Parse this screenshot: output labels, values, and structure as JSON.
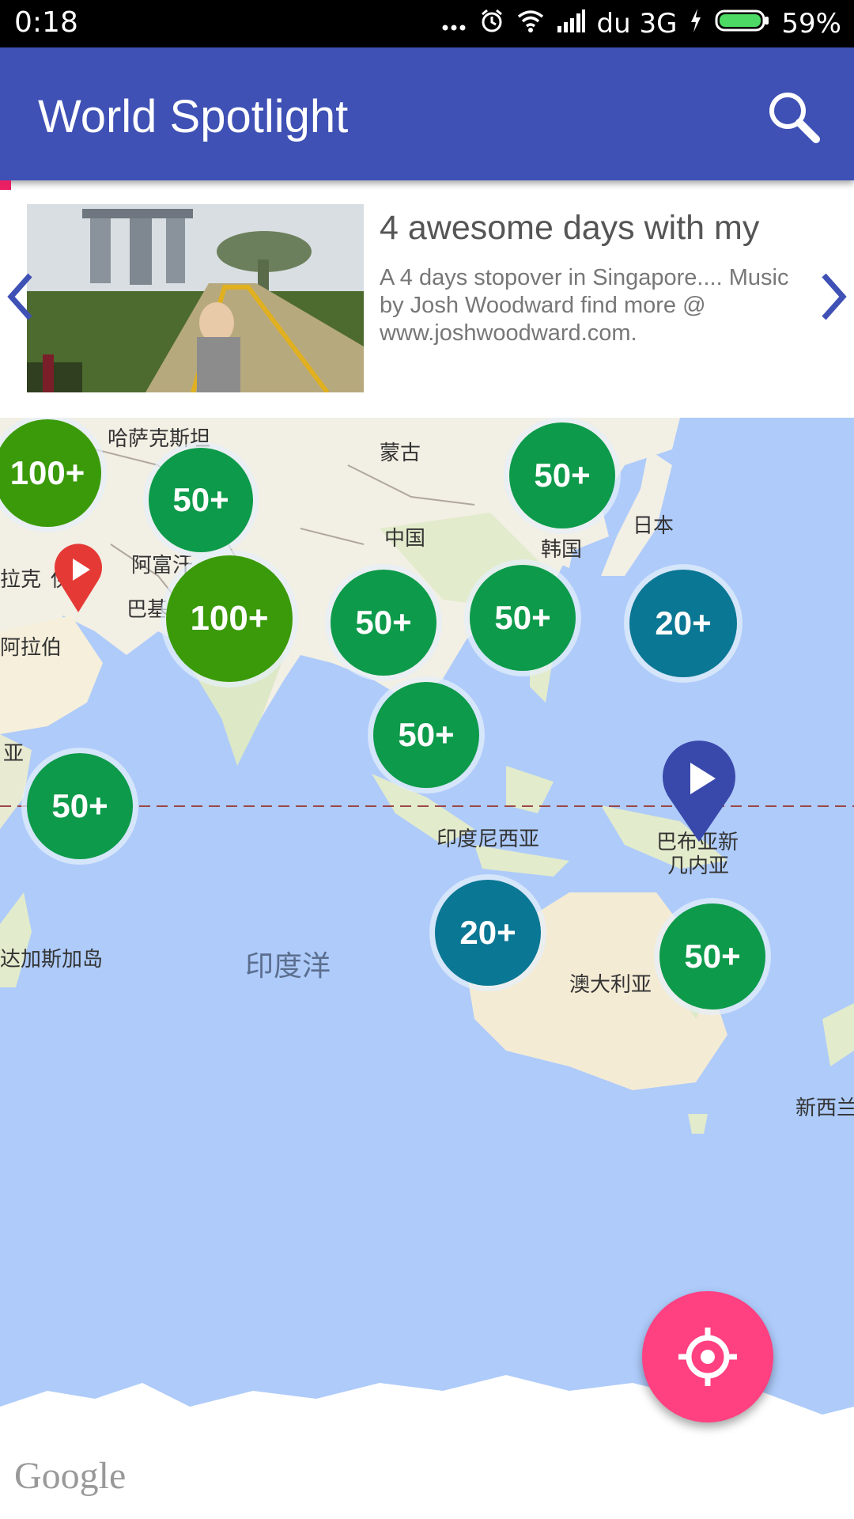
{
  "status_bar": {
    "time": "0:18",
    "carrier": "du 3G",
    "battery": "59%",
    "icons": [
      "more-dots-icon",
      "alarm-icon",
      "wifi-icon",
      "signal-icon",
      "charging-icon",
      "battery-icon"
    ]
  },
  "app_bar": {
    "title": "World Spotlight",
    "search_icon": "search-icon"
  },
  "video_card": {
    "title": "4 awesome days with my",
    "description": "A 4 days stopover in Singapore.... Music by Josh Woodward find more @ www.joshwoodward.com.",
    "prev_icon": "chevron-left-icon",
    "next_icon": "chevron-right-icon"
  },
  "map": {
    "labels": {
      "kazakhstan": "哈萨克斯坦",
      "mongolia": "蒙古",
      "china": "中国",
      "korea": "韩国",
      "japan": "日本",
      "afghanistan": "阿富汗",
      "pakistan": "巴基斯",
      "iraq": "拉克",
      "arabia": "阿拉伯",
      "yi": "伊",
      "east_africa": "亚",
      "indonesia": "印度尼西亚",
      "png_line1": "巴布亚新",
      "png_line2": "几内亚",
      "madagascar": "达加斯加岛",
      "indian_ocean": "印度洋",
      "australia": "澳大利亚",
      "new_zealand": "新西兰"
    },
    "clusters": [
      {
        "label": "100+",
        "color": "#3A9A09"
      },
      {
        "label": "50+",
        "color": "#0D9A4A"
      },
      {
        "label": "50+",
        "color": "#0D9A4A"
      },
      {
        "label": "100+",
        "color": "#3A9A09"
      },
      {
        "label": "50+",
        "color": "#0D9A4A"
      },
      {
        "label": "50+",
        "color": "#0D9A4A"
      },
      {
        "label": "20+",
        "color": "#0A7794"
      },
      {
        "label": "50+",
        "color": "#0D9A4A"
      },
      {
        "label": "50+",
        "color": "#0D9A4A"
      },
      {
        "label": "20+",
        "color": "#0A7794"
      },
      {
        "label": "50+",
        "color": "#0D9A4A"
      }
    ],
    "markers": [
      {
        "icon": "play-marker-icon",
        "color": "#E53935"
      },
      {
        "icon": "play-marker-icon",
        "color": "#3949AB"
      }
    ],
    "attribution": "Google"
  },
  "fab": {
    "icon": "my-location-icon",
    "color": "#FF4081"
  },
  "colors": {
    "primary": "#3F51B5",
    "accent": "#FF4081",
    "water": "#AECBFA",
    "land": "#F2EFE4"
  }
}
